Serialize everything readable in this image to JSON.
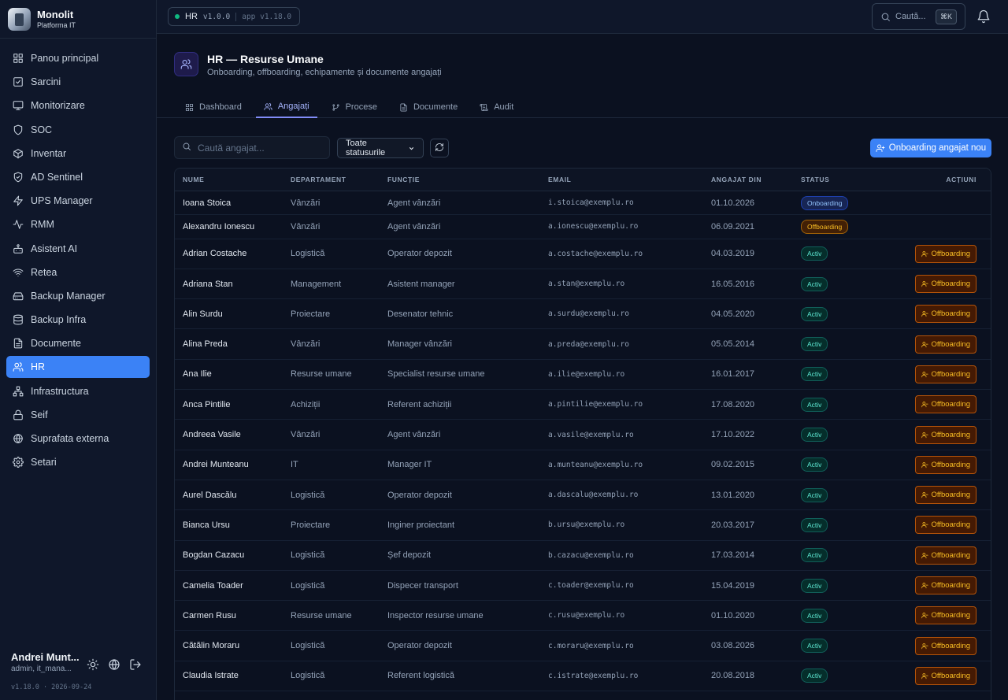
{
  "brand": {
    "name": "Monolit",
    "subtitle": "Platforma IT"
  },
  "sidebar": {
    "items": [
      {
        "label": "Panou principal",
        "icon": "grid-icon"
      },
      {
        "label": "Sarcini",
        "icon": "checkbox-icon"
      },
      {
        "label": "Monitorizare",
        "icon": "monitor-icon"
      },
      {
        "label": "SOC",
        "icon": "shield-icon"
      },
      {
        "label": "Inventar",
        "icon": "box-icon"
      },
      {
        "label": "AD Sentinel",
        "icon": "shield-check-icon"
      },
      {
        "label": "UPS Manager",
        "icon": "zap-icon"
      },
      {
        "label": "RMM",
        "icon": "activity-icon"
      },
      {
        "label": "Asistent AI",
        "icon": "bot-icon"
      },
      {
        "label": "Retea",
        "icon": "wifi-icon"
      },
      {
        "label": "Backup Manager",
        "icon": "drive-icon"
      },
      {
        "label": "Backup Infra",
        "icon": "database-icon"
      },
      {
        "label": "Documente",
        "icon": "file-icon"
      },
      {
        "label": "HR",
        "icon": "users-icon",
        "active": true
      },
      {
        "label": "Infrastructura",
        "icon": "network-icon"
      },
      {
        "label": "Seif",
        "icon": "lock-icon"
      },
      {
        "label": "Suprafata externa",
        "icon": "globe-icon"
      },
      {
        "label": "Setari",
        "icon": "gear-icon"
      }
    ],
    "user": {
      "name": "Andrei Munt...",
      "role": "admin, it_mana..."
    },
    "version": "v1.18.0 · 2026-09-24"
  },
  "topbar": {
    "env": "HR",
    "env_version": "v1.0.0",
    "app_version": "app v1.18.0",
    "search_placeholder": "Caută...",
    "shortcut": "⌘K"
  },
  "page": {
    "title": "HR — Resurse Umane",
    "subtitle": "Onboarding, offboarding, echipamente și documente angajați",
    "tabs": [
      {
        "label": "Dashboard",
        "icon": "grid-icon"
      },
      {
        "label": "Angajați",
        "icon": "users-icon",
        "active": true
      },
      {
        "label": "Procese",
        "icon": "git-branch-icon"
      },
      {
        "label": "Documente",
        "icon": "file-icon"
      },
      {
        "label": "Audit",
        "icon": "scroll-icon"
      }
    ]
  },
  "toolbar": {
    "search_placeholder": "Caută angajat...",
    "status_filter": "Toate statusurile",
    "new_button": "Onboarding angajat nou"
  },
  "colors": {
    "accent": "#3b82f6",
    "onboarding": "#93c5fd",
    "offboarding": "#fbbf24",
    "active": "#5eead4"
  },
  "table": {
    "headers": [
      "NUME",
      "DEPARTAMENT",
      "FUNCȚIE",
      "EMAIL",
      "ANGAJAT DIN",
      "STATUS",
      "ACȚIUNI"
    ],
    "action_label": "Offboarding",
    "rows": [
      {
        "name": "Ioana Stoica",
        "dept": "Vânzări",
        "func": "Agent vânzări",
        "email": "i.stoica@exemplu.ro",
        "date": "01.10.2026",
        "status": "Onboarding",
        "status_type": "onb"
      },
      {
        "name": "Alexandru Ionescu",
        "dept": "Vânzări",
        "func": "Agent vânzări",
        "email": "a.ionescu@exemplu.ro",
        "date": "06.09.2021",
        "status": "Offboarding",
        "status_type": "offb"
      },
      {
        "name": "Adrian Costache",
        "dept": "Logistică",
        "func": "Operator depozit",
        "email": "a.costache@exemplu.ro",
        "date": "04.03.2019",
        "status": "Activ",
        "status_type": "activ"
      },
      {
        "name": "Adriana Stan",
        "dept": "Management",
        "func": "Asistent manager",
        "email": "a.stan@exemplu.ro",
        "date": "16.05.2016",
        "status": "Activ",
        "status_type": "activ"
      },
      {
        "name": "Alin Surdu",
        "dept": "Proiectare",
        "func": "Desenator tehnic",
        "email": "a.surdu@exemplu.ro",
        "date": "04.05.2020",
        "status": "Activ",
        "status_type": "activ"
      },
      {
        "name": "Alina Preda",
        "dept": "Vânzări",
        "func": "Manager vânzări",
        "email": "a.preda@exemplu.ro",
        "date": "05.05.2014",
        "status": "Activ",
        "status_type": "activ"
      },
      {
        "name": "Ana Ilie",
        "dept": "Resurse umane",
        "func": "Specialist resurse umane",
        "email": "a.ilie@exemplu.ro",
        "date": "16.01.2017",
        "status": "Activ",
        "status_type": "activ"
      },
      {
        "name": "Anca Pintilie",
        "dept": "Achiziții",
        "func": "Referent achiziții",
        "email": "a.pintilie@exemplu.ro",
        "date": "17.08.2020",
        "status": "Activ",
        "status_type": "activ"
      },
      {
        "name": "Andreea Vasile",
        "dept": "Vânzări",
        "func": "Agent vânzări",
        "email": "a.vasile@exemplu.ro",
        "date": "17.10.2022",
        "status": "Activ",
        "status_type": "activ"
      },
      {
        "name": "Andrei Munteanu",
        "dept": "IT",
        "func": "Manager IT",
        "email": "a.munteanu@exemplu.ro",
        "date": "09.02.2015",
        "status": "Activ",
        "status_type": "activ"
      },
      {
        "name": "Aurel Dascălu",
        "dept": "Logistică",
        "func": "Operator depozit",
        "email": "a.dascalu@exemplu.ro",
        "date": "13.01.2020",
        "status": "Activ",
        "status_type": "activ"
      },
      {
        "name": "Bianca Ursu",
        "dept": "Proiectare",
        "func": "Inginer proiectant",
        "email": "b.ursu@exemplu.ro",
        "date": "20.03.2017",
        "status": "Activ",
        "status_type": "activ"
      },
      {
        "name": "Bogdan Cazacu",
        "dept": "Logistică",
        "func": "Șef depozit",
        "email": "b.cazacu@exemplu.ro",
        "date": "17.03.2014",
        "status": "Activ",
        "status_type": "activ"
      },
      {
        "name": "Camelia Toader",
        "dept": "Logistică",
        "func": "Dispecer transport",
        "email": "c.toader@exemplu.ro",
        "date": "15.04.2019",
        "status": "Activ",
        "status_type": "activ"
      },
      {
        "name": "Carmen Rusu",
        "dept": "Resurse umane",
        "func": "Inspector resurse umane",
        "email": "c.rusu@exemplu.ro",
        "date": "01.10.2020",
        "status": "Activ",
        "status_type": "activ"
      },
      {
        "name": "Cătălin Moraru",
        "dept": "Logistică",
        "func": "Operator depozit",
        "email": "c.moraru@exemplu.ro",
        "date": "03.08.2026",
        "status": "Activ",
        "status_type": "activ"
      },
      {
        "name": "Claudia Istrate",
        "dept": "Logistică",
        "func": "Referent logistică",
        "email": "c.istrate@exemplu.ro",
        "date": "20.08.2018",
        "status": "Activ",
        "status_type": "activ"
      }
    ]
  }
}
